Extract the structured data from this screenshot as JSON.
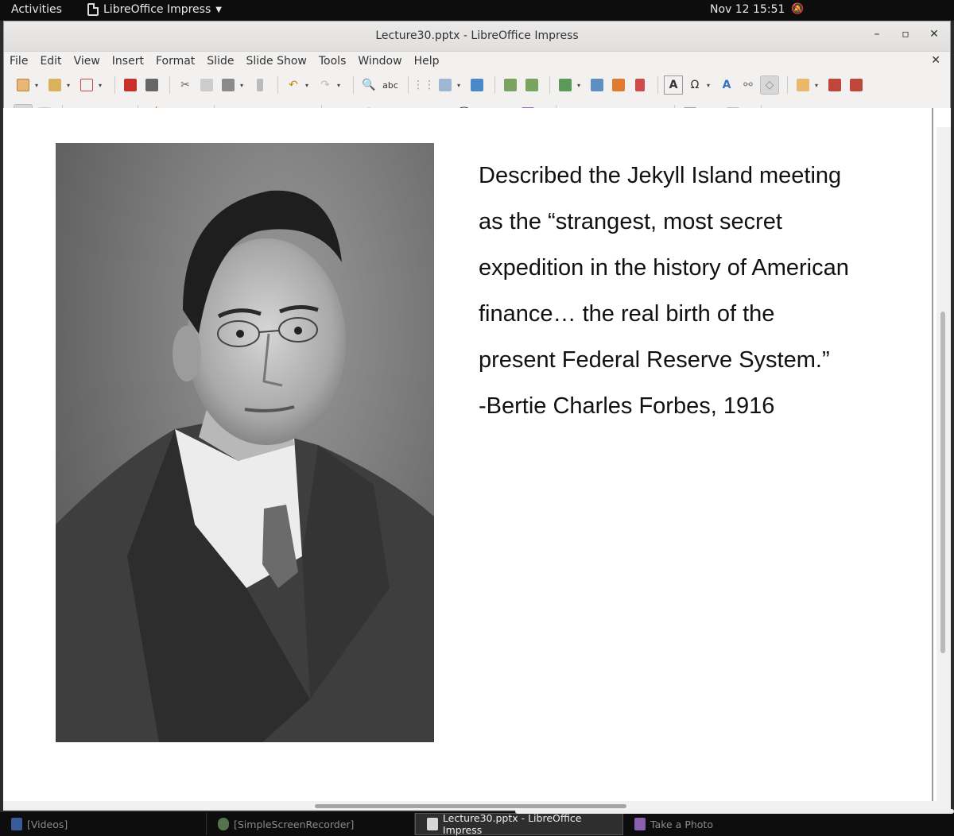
{
  "system_bar": {
    "activities": "Activities",
    "app_name": "LibreOffice Impress",
    "clock": "Nov 12  15:51"
  },
  "window": {
    "title": "Lecture30.pptx - LibreOffice Impress"
  },
  "menu": [
    "File",
    "Edit",
    "View",
    "Insert",
    "Format",
    "Slide",
    "Slide Show",
    "Tools",
    "Window",
    "Help"
  ],
  "slide": {
    "quote_lines": [
      "Described the Jekyll Island meeting",
      "as the “strangest, most secret",
      "expedition in the history of American",
      "finance… the real birth of the",
      "present Federal Reserve System.”",
      "-Bertie Charles Forbes, 1916"
    ]
  },
  "taskbar": {
    "items": [
      {
        "label": "[Videos]",
        "icon": "folder-icon",
        "color": "#3a5b9a"
      },
      {
        "label": "[SimpleScreenRecorder]",
        "icon": "recorder-icon",
        "color": "#55734f"
      },
      {
        "label": "Lecture30.pptx - LibreOffice Impress",
        "icon": "impress-icon",
        "color": "#d8d8d8"
      },
      {
        "label": "Take a Photo",
        "icon": "camera-icon",
        "color": "#8a5fb0"
      }
    ]
  },
  "colors": {
    "top_bar": "#0d0d0d",
    "window_bg": "#f2f1f0",
    "slide_bg": "#ffffff",
    "text": "#111111"
  }
}
